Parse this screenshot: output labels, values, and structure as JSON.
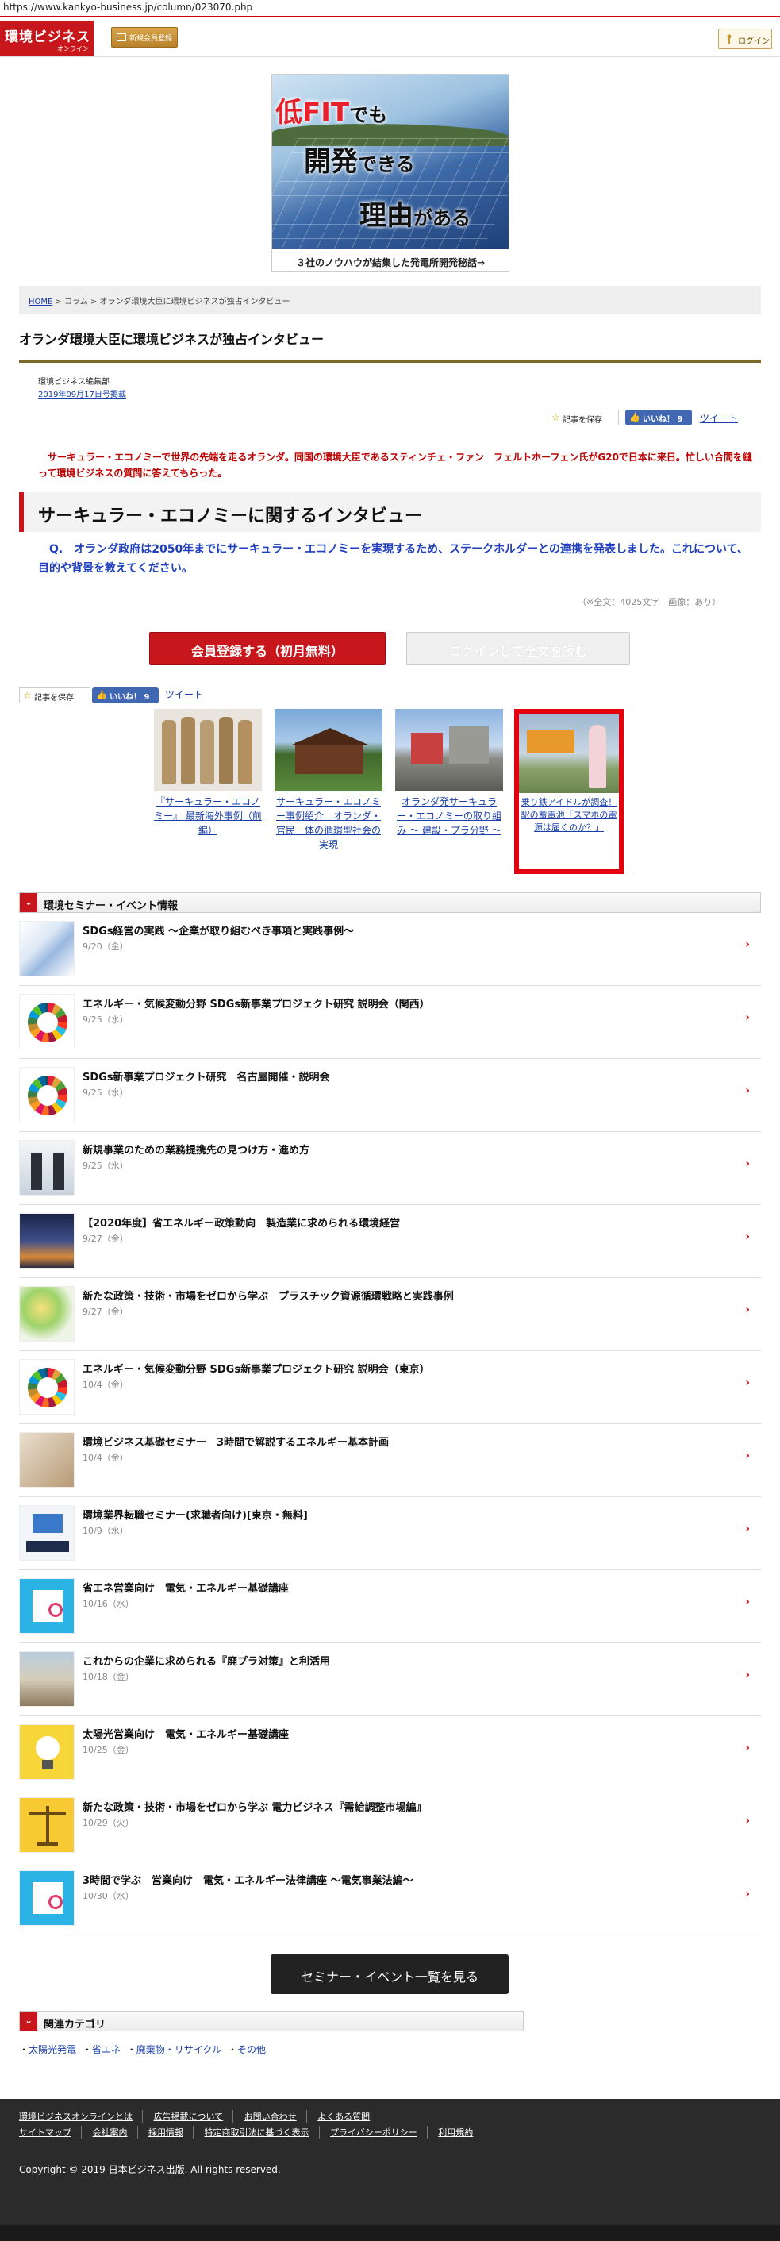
{
  "url": "https://www.kankyo-business.jp/column/023070.php",
  "header": {
    "logo_main": "環境ビジネス",
    "logo_sub": "オンライン",
    "register_label": "新規会員登録",
    "login_label": "ログイン"
  },
  "banner": {
    "line1a": "低FIT",
    "line1b": "でも",
    "line2a": "開発",
    "line2b": "できる",
    "line3a": "理由",
    "line3b": "がある",
    "caption": "３社のノウハウが結集した発電所開発秘話⇒"
  },
  "breadcrumb": {
    "home": "HOME",
    "sep": " > ",
    "column": "コラム",
    "current": "オランダ環境大臣に環境ビジネスが独占インタビュー"
  },
  "article": {
    "title": "オランダ環境大臣に環境ビジネスが独占インタビュー",
    "author": "環境ビジネス編集部",
    "date": "2019年09月17日号掲載",
    "lead": "　サーキュラー・エコノミーで世界の先端を走るオランダ。同国の環境大臣であるスティンチェ・ファン　フェルトホーフェン氏がG20で日本に来日。忙しい合間を縫って環境ビジネスの質問に答えてもらった。",
    "h2": "サーキュラー・エコノミーに関するインタビュー",
    "question": "　Q.　オランダ政府は2050年までにサーキュラー・エコノミーを実現するため、ステークホルダーとの連携を発表しました。これについて、目的や背景を教えてください。",
    "count": "（※全文：4025文字　画像：あり）",
    "cta_register": "会員登録する（初月無料）",
    "cta_login": "ログインして全文を読む"
  },
  "social": {
    "save": "記事を保存",
    "like": "いいね！ 9",
    "tweet": "ツイート"
  },
  "related": [
    {
      "caption": "『サーキュラー・エコノミー』 最新海外事例（前編）"
    },
    {
      "caption": "サーキュラー・エコノミー事例紹介　オランダ・官民一体の循環型社会の実現"
    },
    {
      "caption": "オランダ発サーキュラー・エコノミーの取り組み ～ 建設・プラ分野 ～"
    },
    {
      "caption": "乗り鉄アイドルが調査！駅の蓄電池「スマホの電源は届くのか？」"
    }
  ],
  "events_header": "環境セミナー・イベント情報",
  "events": [
    {
      "title": "SDGs経営の実践 ～企業が取り組むべき事項と実践事例～",
      "date": "9/20（金）"
    },
    {
      "title": "エネルギー・気候変動分野 SDGs新事業プロジェクト研究 説明会（関西）",
      "date": "9/25（水）"
    },
    {
      "title": "SDGs新事業プロジェクト研究　名古屋開催・説明会",
      "date": "9/25（水）"
    },
    {
      "title": "新規事業のための業務提携先の見つけ方・進め方",
      "date": "9/25（水）"
    },
    {
      "title": "【2020年度】省エネルギー政策動向　製造業に求められる環境経営",
      "date": "9/27（金）"
    },
    {
      "title": "新たな政策・技術・市場をゼロから学ぶ　プラスチック資源循環戦略と実践事例",
      "date": "9/27（金）"
    },
    {
      "title": "エネルギー・気候変動分野 SDGs新事業プロジェクト研究 説明会（東京）",
      "date": "10/4（金）"
    },
    {
      "title": "環境ビジネス基礎セミナー　3時間で解説するエネルギー基本計画",
      "date": "10/4（金）"
    },
    {
      "title": "環境業界転職セミナー(求職者向け)[東京・無料]",
      "date": "10/9（水）"
    },
    {
      "title": "省エネ営業向け　電気・エネルギー基礎講座",
      "date": "10/16（水）"
    },
    {
      "title": "これからの企業に求められる『廃プラ対策』と利活用",
      "date": "10/18（金）"
    },
    {
      "title": "太陽光営業向け　電気・エネルギー基礎講座",
      "date": "10/25（金）"
    },
    {
      "title": "新たな政策・技術・市場をゼロから学ぶ 電力ビジネス『需給調整市場編』",
      "date": "10/29（火）"
    },
    {
      "title": "3時間で学ぶ　営業向け　電気・エネルギー法律講座 ～電気事業法編～",
      "date": "10/30（水）"
    }
  ],
  "seminar_button": "セミナー・イベント一覧を見る",
  "categories_header": "関連カテゴリ",
  "categories": [
    "太陽光発電",
    "省エネ",
    "廃棄物・リサイクル",
    "その他"
  ],
  "footer": {
    "row1": [
      "環境ビジネスオンラインとは",
      "広告掲載について",
      "お問い合わせ",
      "よくある質問"
    ],
    "row2": [
      "サイトマップ",
      "会社案内",
      "採用情報",
      "特定商取引法に基づく表示",
      "プライバシーポリシー",
      "利用規約"
    ],
    "copyright": "Copyright © 2019 日本ビジネス出版. All rights reserved."
  },
  "colors": {
    "brand_red": "#c8161d",
    "link_blue": "#1a3fa8",
    "question_blue": "#1f3fbf"
  }
}
